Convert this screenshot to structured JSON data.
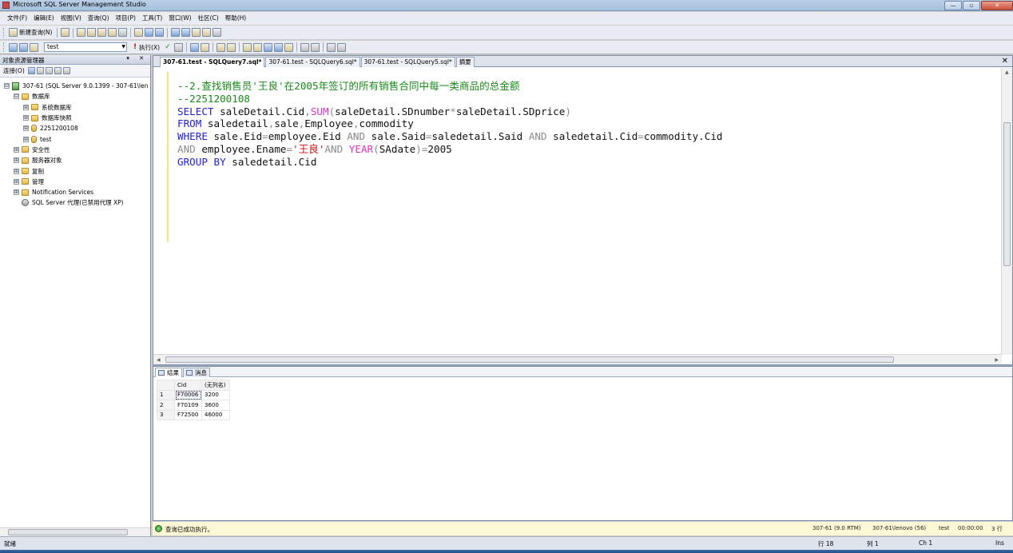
{
  "window": {
    "title": "Microsoft SQL Server Management Studio",
    "buttons": {
      "minimize": "—",
      "maximize": "▫",
      "close": "✕"
    }
  },
  "menu": [
    "文件(F)",
    "编辑(E)",
    "视图(V)",
    "查询(Q)",
    "项目(P)",
    "工具(T)",
    "窗口(W)",
    "社区(C)",
    "帮助(H)"
  ],
  "toolbar": {
    "new_query": "新建查询(N)",
    "database": "test",
    "execute": "执行(X)"
  },
  "object_explorer": {
    "title": "对象资源管理器",
    "header_buttons": "▾ ✕",
    "connect": "连接(O)",
    "tree": [
      {
        "label": "307-61 (SQL Server 9.0.1399 - 307-61\\len",
        "indent": 0,
        "icon": "server-icon",
        "exp": "⊟"
      },
      {
        "label": "数据库",
        "indent": 1,
        "icon": "folder-icon",
        "exp": "⊟"
      },
      {
        "label": "系统数据库",
        "indent": 2,
        "icon": "folder-icon",
        "exp": "⊞"
      },
      {
        "label": "数据库快照",
        "indent": 2,
        "icon": "folder-icon",
        "exp": "⊞"
      },
      {
        "label": "2251200108",
        "indent": 2,
        "icon": "db-icon",
        "exp": "⊞"
      },
      {
        "label": "test",
        "indent": 2,
        "icon": "db-icon",
        "exp": "⊞"
      },
      {
        "label": "安全性",
        "indent": 1,
        "icon": "folder-icon",
        "exp": "⊞"
      },
      {
        "label": "服务器对象",
        "indent": 1,
        "icon": "folder-icon",
        "exp": "⊞"
      },
      {
        "label": "复制",
        "indent": 1,
        "icon": "folder-icon",
        "exp": "⊞"
      },
      {
        "label": "管理",
        "indent": 1,
        "icon": "folder-icon",
        "exp": "⊞"
      },
      {
        "label": "Notification Services",
        "indent": 1,
        "icon": "folder-icon",
        "exp": "⊞"
      },
      {
        "label": "SQL Server 代理(已禁用代理 XP)",
        "indent": 1,
        "icon": "agent-icon",
        "exp": ""
      }
    ]
  },
  "doc_tabs": [
    {
      "label": "307-61.test - SQLQuery7.sql*",
      "active": true
    },
    {
      "label": "307-61.test - SQLQuery6.sql*",
      "active": false
    },
    {
      "label": "307-61.test - SQLQuery5.sql*",
      "active": false
    },
    {
      "label": "摘要",
      "active": false
    }
  ],
  "doc_close": "✕",
  "editor": {
    "lines": [
      [
        {
          "t": "--2.查找销售员'王良'在2005年签订的所有销售合同中每一类商品的总金额",
          "c": "comment"
        }
      ],
      [
        {
          "t": "--2251200108",
          "c": "comment"
        }
      ],
      [
        {
          "t": "SELECT",
          "c": "kw"
        },
        {
          "t": " saleDetail.Cid",
          "c": "plain"
        },
        {
          "t": ",",
          "c": "op"
        },
        {
          "t": "SUM",
          "c": "fn"
        },
        {
          "t": "(",
          "c": "op"
        },
        {
          "t": "saleDetail.SDnumber",
          "c": "plain"
        },
        {
          "t": "*",
          "c": "op"
        },
        {
          "t": "saleDetail.SDprice",
          "c": "plain"
        },
        {
          "t": ")",
          "c": "op"
        }
      ],
      [
        {
          "t": "FROM",
          "c": "kw"
        },
        {
          "t": " saledetail",
          "c": "plain"
        },
        {
          "t": ",",
          "c": "op"
        },
        {
          "t": "sale",
          "c": "plain"
        },
        {
          "t": ",",
          "c": "op"
        },
        {
          "t": "Employee",
          "c": "plain"
        },
        {
          "t": ",",
          "c": "op"
        },
        {
          "t": "commodity",
          "c": "plain"
        }
      ],
      [
        {
          "t": "WHERE",
          "c": "kw"
        },
        {
          "t": " sale.Eid",
          "c": "plain"
        },
        {
          "t": "=",
          "c": "op"
        },
        {
          "t": "employee.Eid ",
          "c": "plain"
        },
        {
          "t": "AND",
          "c": "op"
        },
        {
          "t": " sale.Said",
          "c": "plain"
        },
        {
          "t": "=",
          "c": "op"
        },
        {
          "t": "saledetail.Said ",
          "c": "plain"
        },
        {
          "t": "AND",
          "c": "op"
        },
        {
          "t": " saledetail.Cid",
          "c": "plain"
        },
        {
          "t": "=",
          "c": "op"
        },
        {
          "t": "commodity.Cid",
          "c": "plain"
        }
      ],
      [
        {
          "t": "AND",
          "c": "op"
        },
        {
          "t": " employee.Ename",
          "c": "plain"
        },
        {
          "t": "=",
          "c": "op"
        },
        {
          "t": "'王良'",
          "c": "str"
        },
        {
          "t": "AND ",
          "c": "op"
        },
        {
          "t": "YEAR",
          "c": "fn"
        },
        {
          "t": "(",
          "c": "op"
        },
        {
          "t": "SAdate",
          "c": "plain"
        },
        {
          "t": ")",
          "c": "op"
        },
        {
          "t": "=",
          "c": "op"
        },
        {
          "t": "2005",
          "c": "plain"
        }
      ],
      [
        {
          "t": "GROUP BY",
          "c": "kw"
        },
        {
          "t": " saledetail.Cid",
          "c": "plain"
        }
      ]
    ]
  },
  "results": {
    "tabs": [
      {
        "label": "结果",
        "active": true
      },
      {
        "label": "消息",
        "active": false
      }
    ],
    "columns": [
      "Cid",
      "(无列名)"
    ],
    "rows": [
      {
        "n": "1",
        "cells": [
          "F70006",
          "3200"
        ]
      },
      {
        "n": "2",
        "cells": [
          "F70109",
          "3600"
        ]
      },
      {
        "n": "3",
        "cells": [
          "F72500",
          "46000"
        ]
      }
    ]
  },
  "exec_status": {
    "message": "查询已成功执行。",
    "server": "307-61 (9.0 RTM)",
    "login": "307-61\\lenovo (56)",
    "database": "test",
    "elapsed": "00:00:00",
    "rows": "3 行"
  },
  "statusbar": {
    "ready": "就绪",
    "line": "行 18",
    "col": "列 1",
    "ch": "Ch 1",
    "mode": "Ins"
  }
}
